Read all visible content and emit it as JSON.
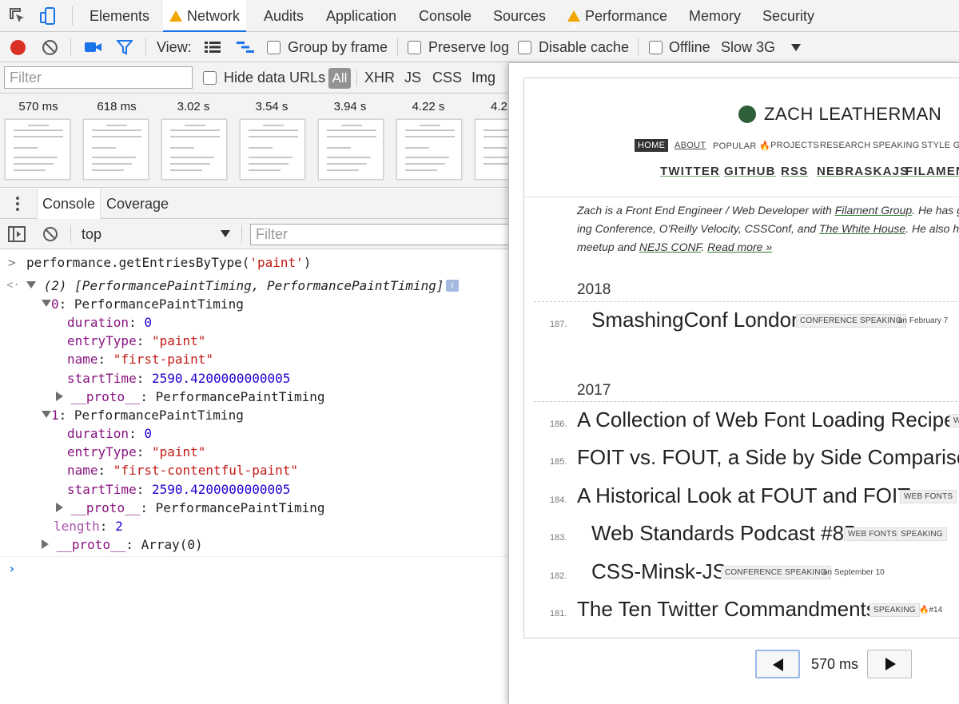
{
  "tabs": {
    "items": [
      "Elements",
      "Network",
      "Audits",
      "Application",
      "Console",
      "Sources",
      "Performance",
      "Memory",
      "Security"
    ]
  },
  "network_toolbar": {
    "view_label": "View:",
    "group_by_frame": "Group by frame",
    "preserve_log": "Preserve log",
    "disable_cache": "Disable cache",
    "offline": "Offline",
    "throttle": "Slow 3G"
  },
  "filter_bar": {
    "placeholder": "Filter",
    "hide_data_urls": "Hide data URLs",
    "types": [
      "All",
      "XHR",
      "JS",
      "CSS",
      "Img"
    ]
  },
  "filmstrip": {
    "times": [
      "570 ms",
      "618 ms",
      "3.02 s",
      "3.54 s",
      "3.94 s",
      "4.22 s",
      "4.2"
    ]
  },
  "drawer": {
    "tabs": [
      "Console",
      "Coverage"
    ],
    "context": "top",
    "filter_placeholder": "Filter"
  },
  "console": {
    "command": "performance.getEntriesByType('paint')",
    "summary": "(2) [PerformancePaintTiming, PerformancePaintTiming]",
    "entries": [
      {
        "index": "0",
        "type": "PerformancePaintTiming",
        "duration": "0",
        "entryType": "\"paint\"",
        "name": "\"first-paint\"",
        "startTime": "2590.4200000000005",
        "proto": "PerformancePaintTiming"
      },
      {
        "index": "1",
        "type": "PerformancePaintTiming",
        "duration": "0",
        "entryType": "\"paint\"",
        "name": "\"first-contentful-paint\"",
        "startTime": "2590.4200000000005",
        "proto": "PerformancePaintTiming"
      }
    ],
    "keys": {
      "duration": "duration",
      "entryType": "entryType",
      "name": "name",
      "startTime": "startTime",
      "proto": "__proto__",
      "length": "length"
    },
    "length": "2",
    "array_proto": "Array(0)"
  },
  "screenshot": {
    "site_title": "ZACH LEATHERMAN",
    "nav": [
      "HOME",
      "ABOUT",
      "POPULAR",
      "PROJECTS",
      "RESEARCH",
      "SPEAKING",
      "STYLE GU"
    ],
    "social": [
      "TWITTER",
      "GITHUB",
      "RSS",
      "NEBRASKAJS",
      "FILAMENT"
    ],
    "bio": {
      "line1_pre": "Zach is a Front End Engineer / Web Developer with ",
      "line1_link": "Filament Group",
      "line1_post": ". He has gi",
      "line2_pre": "ing Conference, O'Reilly Velocity, CSSConf, and ",
      "line2_link": "The White House",
      "line2_post": ". He also he",
      "line3_pre": "meetup and ",
      "line3_link": "NEJS CONF",
      "line3_mid": ". ",
      "line3_more": "Read more »"
    },
    "years": [
      "2018",
      "2017"
    ],
    "posts": [
      {
        "num": "187.",
        "title": "SmashingConf London",
        "tags": [
          "CONFERENCE SPEAKING"
        ],
        "date": "on February 7"
      },
      {
        "num": "186.",
        "title": "A Collection of Web Font Loading Recipes",
        "tags": [
          "W"
        ],
        "date": ""
      },
      {
        "num": "185.",
        "title": "FOIT vs. FOUT, a Side by Side Comparison",
        "tags": [],
        "date": ""
      },
      {
        "num": "184.",
        "title": "A Historical Look at FOUT and FOIT",
        "tags": [
          "WEB FONTS"
        ],
        "date": ""
      },
      {
        "num": "183.",
        "title": "Web Standards Podcast #85",
        "tags": [
          "WEB FONTS",
          "SPEAKING"
        ],
        "date": ""
      },
      {
        "num": "182.",
        "title": "CSS-Minsk-JS",
        "tags": [
          "CONFERENCE SPEAKING"
        ],
        "date": "on September 10"
      },
      {
        "num": "181.",
        "title": "The Ten Twitter Commandments",
        "tags": [
          "SPEAKING"
        ],
        "date": "#14"
      }
    ],
    "frame_time": "570 ms"
  },
  "colors": {
    "accent": "#1a73e8",
    "record": "#d93025",
    "warning": "#f2a600",
    "logo_green": "#2f5f3a"
  }
}
